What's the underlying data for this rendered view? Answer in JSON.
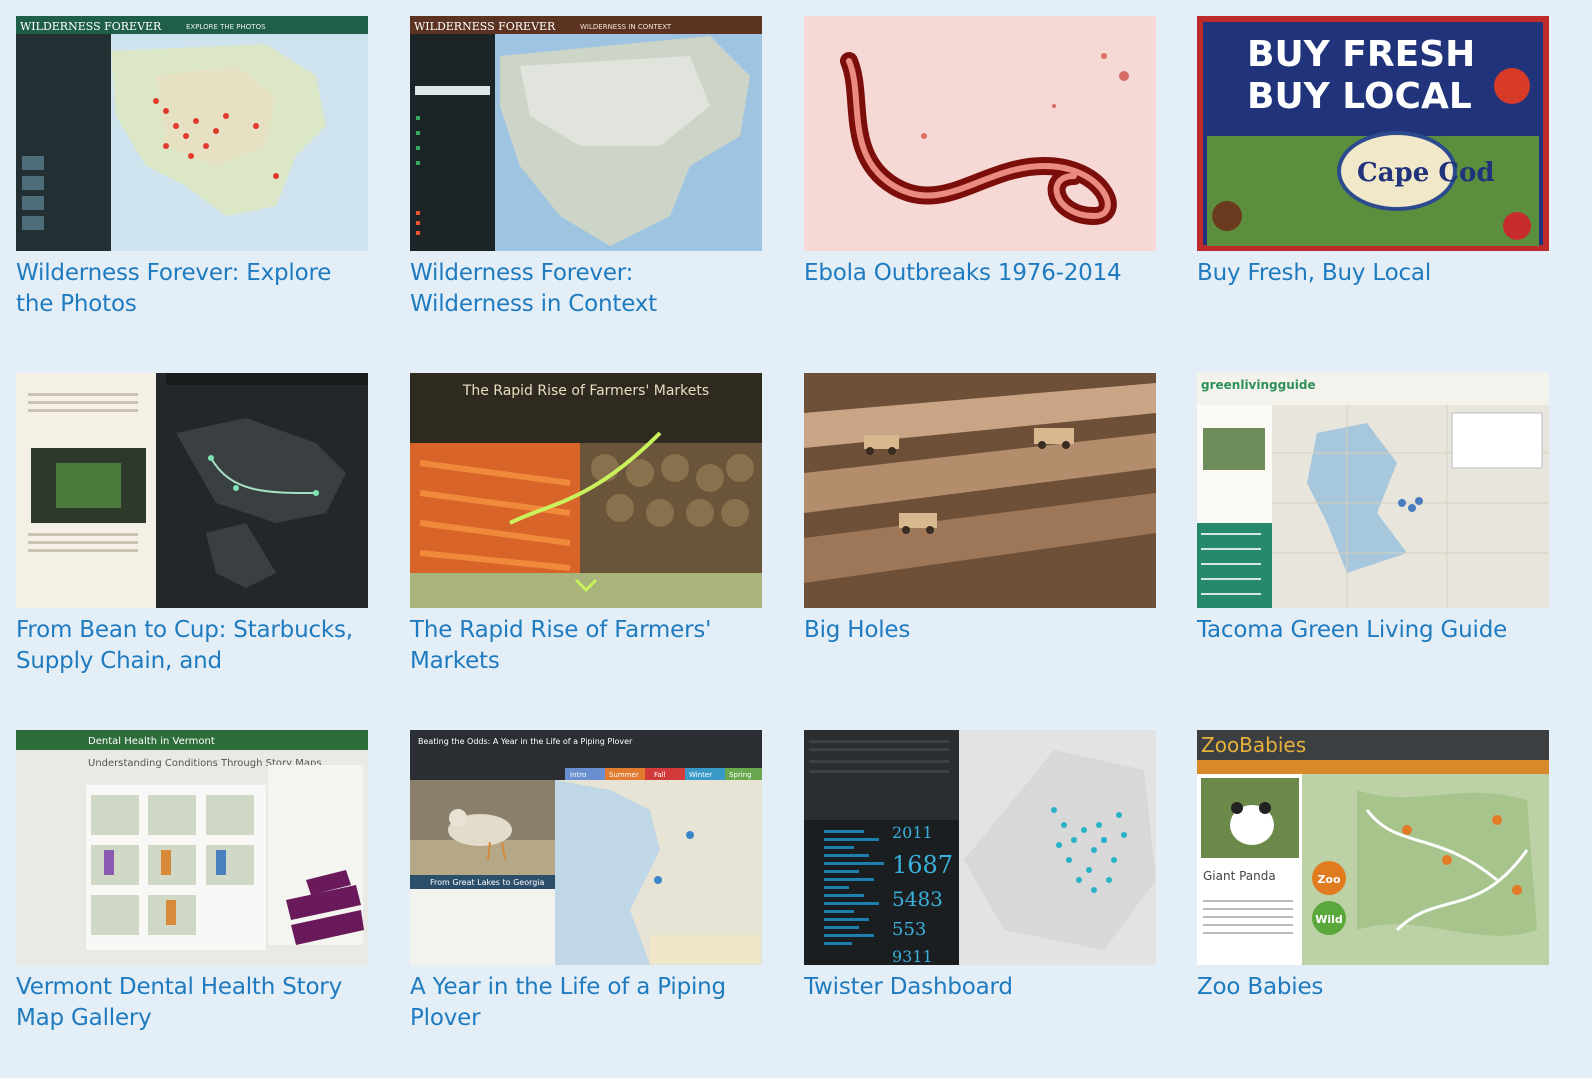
{
  "gallery": {
    "items": [
      {
        "title": "Wilderness Forever: Explore the Photos",
        "thumb_header": "WILDERNESS FOREVER",
        "thumb_subheader": "EXPLORE THE PHOTOS"
      },
      {
        "title": "Wilderness Forever: Wilderness in Context",
        "thumb_header": "WILDERNESS FOREVER",
        "thumb_subheader": "WILDERNESS IN CONTEXT"
      },
      {
        "title": "Ebola Outbreaks 1976-2014"
      },
      {
        "title": "Buy Fresh, Buy Local",
        "thumb_line1": "BUY FRESH",
        "thumb_line2": "BUY LOCAL",
        "thumb_badge": "Cape Cod"
      },
      {
        "title": "From Bean to Cup: Starbucks, Supply Chain, and"
      },
      {
        "title": "The Rapid Rise of Farmers' Markets",
        "thumb_header": "The Rapid Rise of Farmers' Markets"
      },
      {
        "title": "Big Holes"
      },
      {
        "title": "Tacoma Green Living Guide",
        "thumb_header": "greenlivingguide"
      },
      {
        "title": "Vermont Dental Health Story Map Gallery",
        "thumb_header": "Dental Health in Vermont",
        "thumb_subheader": "Understanding Conditions Through Story Maps"
      },
      {
        "title": "A Year in the Life of a Piping Plover",
        "thumb_header": "Beating the Odds: A Year in the Life of a Piping Plover",
        "thumb_caption": "From Great Lakes to Georgia",
        "thumb_tabs": [
          "Intro",
          "Summer",
          "Fall",
          "Winter",
          "Spring"
        ]
      },
      {
        "title": "Twister Dashboard",
        "thumb_stats": [
          "2011",
          "1687",
          "5483",
          "553",
          "9311"
        ]
      },
      {
        "title": "Zoo Babies",
        "thumb_header": "ZooBabies",
        "thumb_caption": "Giant Panda",
        "thumb_badges": [
          "Zoo",
          "Wild"
        ]
      }
    ]
  },
  "colors": {
    "background": "#e4eef7",
    "link": "#1f7bbf"
  }
}
